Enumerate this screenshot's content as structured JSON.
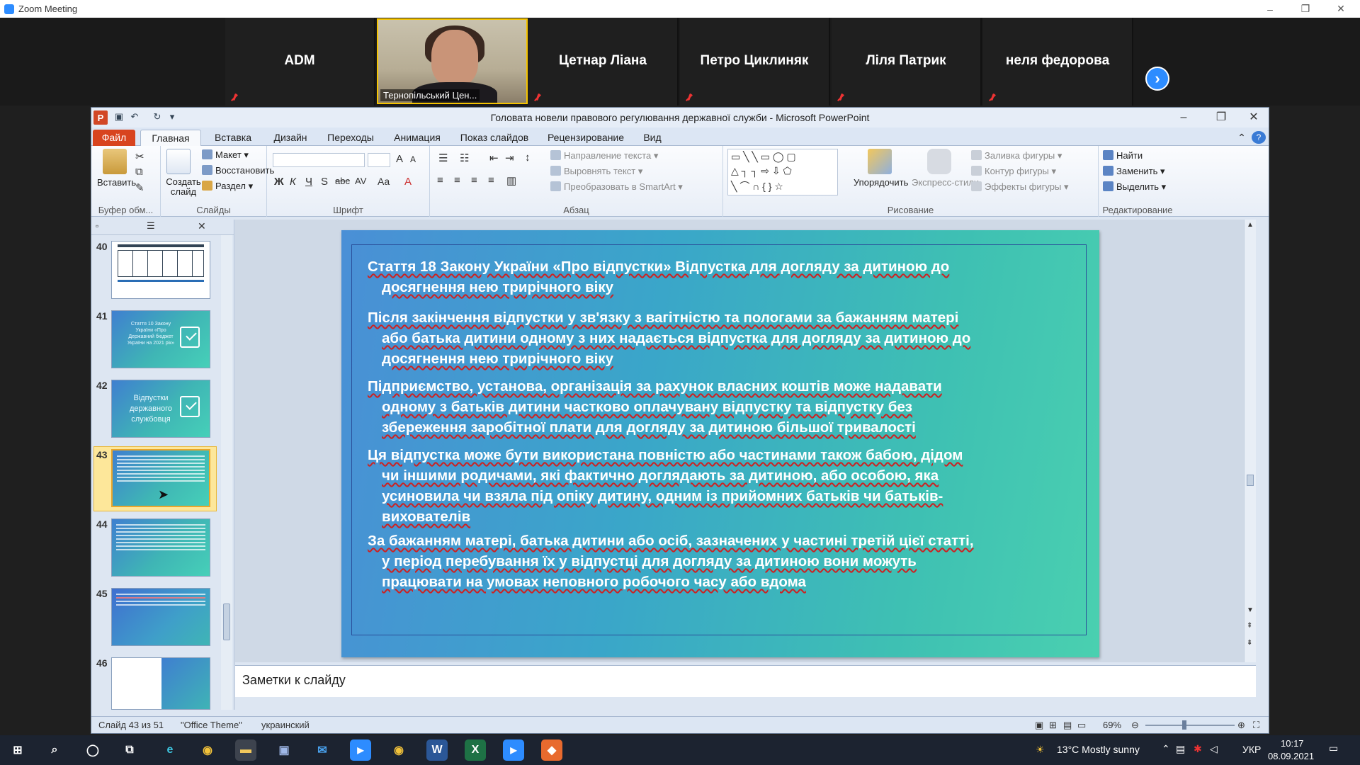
{
  "zoom": {
    "title": "Zoom Meeting",
    "participants": [
      {
        "name": "ADM"
      },
      {
        "name": "Тернопільський Цен...",
        "video": true
      },
      {
        "name": "Цетнар Ліана"
      },
      {
        "name": "Петро Циклиняк"
      },
      {
        "name": "Ліля Патрик"
      },
      {
        "name": "неля федорова"
      }
    ]
  },
  "ppt": {
    "window_title": "Головата новели правового регулювання державної служби - Microsoft PowerPoint",
    "tabs": [
      "Файл",
      "Главная",
      "Вставка",
      "Дизайн",
      "Переходы",
      "Анимация",
      "Показ слайдов",
      "Рецензирование",
      "Вид"
    ],
    "ribbon": {
      "clipboard": {
        "paste": "Вставить",
        "label": "Буфер обм..."
      },
      "slides": {
        "new_slide": "Создать слайд",
        "layout": "Макет",
        "reset": "Восстановить",
        "section": "Раздел",
        "label": "Слайды"
      },
      "font": {
        "label": "Шрифт",
        "bold": "Ж",
        "italic": "К",
        "underline": "Ч",
        "strike": "abc",
        "shadow": "S",
        "spacing": "AV",
        "case": "Aa",
        "color": "A"
      },
      "paragraph": {
        "text_direction": "Направление текста",
        "align_text": "Выровнять текст",
        "smartart": "Преобразовать в SmartArt",
        "label": "Абзац"
      },
      "drawing": {
        "arrange": "Упорядочить",
        "quick_styles": "Экспресс-стили",
        "fill": "Заливка фигуры",
        "outline": "Контур фигуры",
        "effects": "Эффекты фигуры",
        "label": "Рисование"
      },
      "editing": {
        "find": "Найти",
        "replace": "Заменить",
        "select": "Выделить",
        "label": "Редактирование"
      }
    },
    "thumbnails": [
      {
        "num": "40",
        "style": "white"
      },
      {
        "num": "41",
        "style": "teal",
        "text": "Стаття 10 Закону України «Про Державний бюджет України на 2021 рік»"
      },
      {
        "num": "42",
        "style": "teal",
        "text": "Відпустки державного службовця"
      },
      {
        "num": "43",
        "style": "teal",
        "selected": true
      },
      {
        "num": "44",
        "style": "teal"
      },
      {
        "num": "45",
        "style": "teal"
      },
      {
        "num": "46",
        "style": "white"
      }
    ],
    "slide": {
      "paragraphs": [
        {
          "first": "Стаття 18 Закону України «Про відпустки» Відпустка для догляду за дитиною до",
          "rest": "досягнення нею трирічного віку"
        },
        {
          "first": "Після закінчення відпустки у зв'язку з вагітністю та пологами за бажанням матері",
          "rest": "або батька дитини одному з них надається відпустка для догляду за дитиною до",
          "rest2": "досягнення нею трирічного віку"
        },
        {
          "first": "Підприємство, установа, організація за рахунок власних коштів може надавати",
          "rest": "одному з батьків дитини частково оплачувану відпустку та відпустку без",
          "rest2": "збереження заробітної плати для догляду за дитиною більшої тривалості"
        },
        {
          "first": "Ця відпустка може бути використана повністю або частинами також бабою, дідом",
          "rest": "чи іншими родичами, які фактично доглядають за дитиною, або особою, яка",
          "rest2": "усиновила чи взяла під опіку дитину, одним із прийомних батьків чи батьків-",
          "rest3": "вихователів"
        },
        {
          "first": "За бажанням матері, батька дитини або осіб, зазначених у частині третій цієї статті,",
          "rest": "у період перебування їх у відпустці для догляду за дитиною вони можуть",
          "rest2": "працювати на умовах неповного робочого часу або вдома"
        }
      ]
    },
    "notes_placeholder": "Заметки к слайду",
    "status": {
      "slide": "Слайд 43 из 51",
      "theme": "\"Office Theme\"",
      "lang": "украинский",
      "zoom": "69%"
    }
  },
  "taskbar": {
    "weather": "13°C  Mostly sunny",
    "lang": "УКР",
    "time": "10:17",
    "date": "08.09.2021"
  },
  "colors": {
    "zoom_blue": "#2d8cff",
    "ppt_file_tab": "#d8441e",
    "slide_teal": "#3ec0b3",
    "slide_blue": "#4a8fd6"
  }
}
